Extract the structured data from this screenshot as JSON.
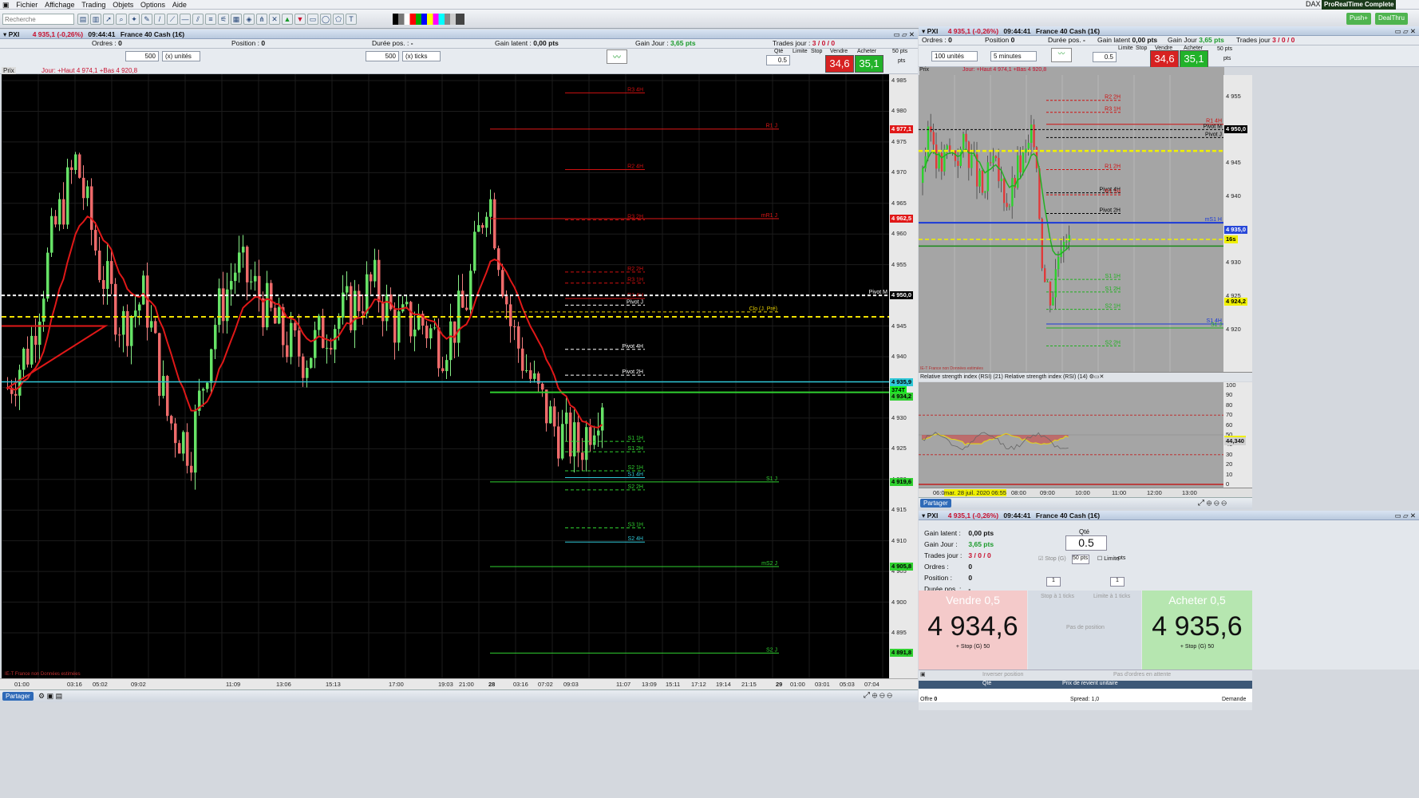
{
  "menu": {
    "items": [
      "Fichier",
      "Affichage",
      "Trading",
      "Objets",
      "Options",
      "Aide"
    ],
    "search_placeholder": "Recherche",
    "dax": "DAX",
    "product": "ProRealTime Complete",
    "push": "Push+",
    "dealthru": "DealThru"
  },
  "left": {
    "header": {
      "symbol": "PXI",
      "price": "4 935,1 (-0,26%)",
      "time": "09:44:41",
      "name": "France 40 Cash (1€)"
    },
    "orders": {
      "ordres_label": "Ordres :",
      "ordres_val": "0",
      "position_label": "Position :",
      "position_val": "0",
      "duree_label": "Durée pos. :",
      "duree_val": "-",
      "gain_latent_label": "Gain latent :",
      "gain_latent_val": "0,00 pts",
      "gain_jour_label": "Gain Jour :",
      "gain_jour_val": "3,65 pts",
      "trades_label": "Trades jour :",
      "trades_val": "3 / 0 / 0"
    },
    "qty1": "500",
    "unit1": "(x) unités",
    "qty2": "500",
    "unit2": "(x) ticks",
    "trade": {
      "qte_label": "Qté",
      "qte_val": "0.5",
      "limite": "Limite",
      "stop": "Stop",
      "vendre": "Vendre",
      "acheter": "Acheter",
      "sell_price": "4 934,6",
      "buy_price": "4 935,1",
      "sell_big": "34,6",
      "buy_big": "35,1",
      "pts": "50 pts",
      "pts2": "pts"
    },
    "chart_title": "Prix",
    "chart_sub": "Jour: +Haut 4 974,1 +Bas 4 920,8",
    "footer_note": "IE-T France non Données estimées",
    "share": "Partager",
    "price_ticks": [
      "4 985",
      "4 980",
      "4 975",
      "4 970",
      "4 965",
      "4 960",
      "4 955",
      "4 950",
      "4 945",
      "4 940",
      "4 935",
      "4 930",
      "4 925",
      "4 920",
      "4 915",
      "4 910",
      "4 905",
      "4 900",
      "4 895"
    ],
    "time_ticks": [
      "01:00",
      "03:16",
      "05:02",
      "09:02",
      "11:09",
      "13:06",
      "15:13",
      "17:00",
      "19:03",
      "21:00",
      "28",
      "03:16",
      "07:02",
      "09:03",
      "11:07",
      "13:09",
      "15:11",
      "17:12",
      "19:14",
      "21:15",
      "29",
      "01:00",
      "03:01",
      "05:03",
      "07:04"
    ],
    "levels": [
      {
        "label": "R3 4H",
        "price": 4983,
        "color": "#d01010",
        "dash": false
      },
      {
        "label": "R1 J",
        "price": 4977.1,
        "color": "#e01818",
        "dash": false
      },
      {
        "label": "R2 4H",
        "price": 4970.5,
        "color": "#d01010",
        "dash": false
      },
      {
        "label": "mR1 J",
        "price": 4962.5,
        "color": "#e01818",
        "dash": false
      },
      {
        "label": "R3 2H",
        "price": 4962.3,
        "color": "#d01010",
        "dash": true
      },
      {
        "label": "R2 2H",
        "price": 4953.8,
        "color": "#d01010",
        "dash": true
      },
      {
        "label": "R3 1H",
        "price": 4952,
        "color": "#d01010",
        "dash": true
      },
      {
        "label": "R1 4H",
        "price": 4949.5,
        "color": "#d01010",
        "dash": false
      },
      {
        "label": "Pivot M",
        "price": 4950,
        "color": "#ffffff",
        "dash": true
      },
      {
        "label": "Pivot J",
        "price": 4948.4,
        "color": "#ffffff",
        "dash": true
      },
      {
        "label": "Clo (J. Pré)",
        "price": 4947.3,
        "color": "#e8d000",
        "dash": true
      },
      {
        "label": "Pivot 4H",
        "price": 4941.2,
        "color": "#ffffff",
        "dash": true
      },
      {
        "label": "Pivot 2H",
        "price": 4937,
        "color": "#ffffff",
        "dash": true
      },
      {
        "label": "S1 1H",
        "price": 4926.2,
        "color": "#30d030",
        "dash": true
      },
      {
        "label": "S1 2H",
        "price": 4924.5,
        "color": "#30d030",
        "dash": true
      },
      {
        "label": "S2 1H",
        "price": 4921.4,
        "color": "#30d030",
        "dash": true
      },
      {
        "label": "S1 4H",
        "price": 4920.3,
        "color": "#30c8d8",
        "dash": false
      },
      {
        "label": "S1 J",
        "price": 4919.6,
        "color": "#30d030",
        "dash": false
      },
      {
        "label": "S2 2H",
        "price": 4918.3,
        "color": "#30d030",
        "dash": true
      },
      {
        "label": "S3 1H",
        "price": 4912.1,
        "color": "#30d030",
        "dash": true
      },
      {
        "label": "S2 4H",
        "price": 4909.8,
        "color": "#30c8d8",
        "dash": false
      },
      {
        "label": "mS2 J",
        "price": 4905.8,
        "color": "#30d030",
        "dash": false
      },
      {
        "label": "S2 J",
        "price": 4891.7,
        "color": "#30d030",
        "dash": false
      }
    ],
    "price_tags": [
      {
        "text": "4 950,0",
        "price": 4950,
        "bg": "#000",
        "fg": "#fff"
      },
      {
        "text": "4 935,9",
        "price": 4935.9,
        "bg": "#30c8d8",
        "fg": "#000"
      },
      {
        "text": "374T",
        "price": 4934.6,
        "bg": "#16f020",
        "fg": "#000"
      },
      {
        "text": "4 934,2",
        "price": 4933.5,
        "bg": "#30d030",
        "fg": "#000"
      },
      {
        "text": "4 977,1",
        "price": 4977.1,
        "bg": "#e01818",
        "fg": "#fff"
      },
      {
        "text": "4 962,5",
        "price": 4962.5,
        "bg": "#e01818",
        "fg": "#fff"
      },
      {
        "text": "4 919,6",
        "price": 4919.6,
        "bg": "#30d030",
        "fg": "#000"
      },
      {
        "text": "4 905,8",
        "price": 4905.8,
        "bg": "#30d030",
        "fg": "#000"
      },
      {
        "text": "4 891,8",
        "price": 4891.8,
        "bg": "#30d030",
        "fg": "#000"
      }
    ]
  },
  "right": {
    "header": {
      "symbol": "PXI",
      "price": "4 935,1 (-0,26%)",
      "time": "09:44:41",
      "name": "France 40 Cash (1€)"
    },
    "orders": {
      "ordres": "Ordres :",
      "ordres_val": "0",
      "position": "Position",
      "position_val": "0",
      "duree": "Durée pos.",
      "duree_val": "-",
      "gain_latent": "Gain latent",
      "gain_latent_val": "0,00 pts",
      "gain_jour": "Gain Jour",
      "gain_jour_val": "3,65 pts",
      "trades": "Trades jour",
      "trades_val": "3 / 0 / 0"
    },
    "units": "100 unités",
    "interval": "5 minutes",
    "trade": {
      "qte_val": "0.5",
      "limite": "Limite",
      "stop": "Stop",
      "vendre": "Vendre",
      "acheter": "Acheter",
      "sell_big": "34,6",
      "buy_big": "35,1",
      "pts": "50 pts",
      "pts2": "pts"
    },
    "chart_sub": "Jour: +Haut 4 974,1 +Bas 4 920,8",
    "chart_title": "Prix",
    "footer_note": "IE-T France non Données estimées",
    "price_ticks": [
      "4 955",
      "4 950",
      "4 945",
      "4 940",
      "4 935",
      "4 930",
      "4 925",
      "4 920"
    ],
    "price_tags": [
      {
        "text": "4 950,0",
        "price": 4950,
        "bg": "#000",
        "fg": "#fff"
      },
      {
        "text": "4 935,0",
        "price": 4935,
        "bg": "#2848d8",
        "fg": "#fff"
      },
      {
        "text": "16s",
        "price": 4933.5,
        "bg": "#f0f000",
        "fg": "#000"
      },
      {
        "text": "4 924,2",
        "price": 4924.2,
        "bg": "#f0f000",
        "fg": "#000"
      }
    ],
    "levels": [
      {
        "label": "R2 2H",
        "price": 4954.4,
        "color": "#d01010",
        "dash": true
      },
      {
        "label": "R3 1H",
        "price": 4952.6,
        "color": "#d01010",
        "dash": true
      },
      {
        "label": "R1 4H",
        "price": 4950.8,
        "color": "#d01010",
        "dash": false
      },
      {
        "label": "Pivot M",
        "price": 4950,
        "color": "#000",
        "dash": true
      },
      {
        "label": "Pivot J",
        "price": 4948.8,
        "color": "#000",
        "dash": true
      },
      {
        "label": "R1 2H",
        "price": 4944,
        "color": "#d01010",
        "dash": true
      },
      {
        "label": "Pivot 4H",
        "price": 4940.5,
        "color": "#000",
        "dash": true
      },
      {
        "label": "R1 1H",
        "price": 4940.2,
        "color": "#d01010",
        "dash": true
      },
      {
        "label": "Pivot 2H",
        "price": 4937.4,
        "color": "#000",
        "dash": true
      },
      {
        "label": "mS1 H",
        "price": 4936,
        "color": "#1a3ad8",
        "dash": false
      },
      {
        "label": "S1 1H",
        "price": 4927.5,
        "color": "#20b020",
        "dash": true
      },
      {
        "label": "S1 2H",
        "price": 4925.6,
        "color": "#20b020",
        "dash": true
      },
      {
        "label": "S2 1H",
        "price": 4923,
        "color": "#20b020",
        "dash": true
      },
      {
        "label": "S1 4H",
        "price": 4920.8,
        "color": "#1a3ad8",
        "dash": false
      },
      {
        "label": "S1 J",
        "price": 4920.2,
        "color": "#20b020",
        "dash": false
      },
      {
        "label": "S2 2H",
        "price": 4917.5,
        "color": "#20b020",
        "dash": true
      }
    ],
    "rsi_title": "Relative strength index (RSI) (21)  Relative strength index (RSI) (14)",
    "rsi_ticks": [
      "100",
      "90",
      "80",
      "70",
      "60",
      "50",
      "40",
      "30",
      "20",
      "10",
      "0"
    ],
    "rsi_tags": [
      {
        "text": "45,257",
        "val": 45.3,
        "bg": "#f0f000"
      },
      {
        "text": "44,340",
        "val": 43.3,
        "bg": "#d0d0d0"
      }
    ],
    "time_ticks": [
      "06:0",
      "mar. 28 juil. 2020 06:55",
      "08:00",
      "09:00",
      "10:00",
      "11:00",
      "12:00",
      "13:00"
    ],
    "share": "Partager"
  },
  "ticket": {
    "header": {
      "symbol": "PXI",
      "price": "4 935,1 (-0,26%)",
      "time": "09:44:41",
      "name": "France 40 Cash (1€)"
    },
    "gain_latent": "Gain latent :",
    "gain_latent_val": "0,00 pts",
    "gain_jour": "Gain Jour :",
    "gain_jour_val": "3,65 pts",
    "trades": "Trades jour :",
    "trades_val": "3 / 0 / 0",
    "ordres": "Ordres :",
    "ordres_val": "0",
    "position": "Position :",
    "position_val": "0",
    "duree": "Durée pos. :",
    "duree_val": "-",
    "qte_label": "Qté",
    "qte_val": "0.5",
    "stop_label": "Stop (G)",
    "stop_pts": "50 pts",
    "limite": "Limite",
    "limite_pts": "pts",
    "stepper1": "1",
    "stepper2": "1",
    "sell_title": "Vendre 0,5",
    "sell_price": "4 934,6",
    "sell_sub": "+ Stop (G) 50",
    "buy_title": "Acheter 0,5",
    "buy_price": "4 935,6",
    "buy_sub": "+ Stop (G) 50",
    "stop_a": "Stop à 1 ticks",
    "limite_a": "Limite à 1 ticks",
    "pas_pos": "Pas de position",
    "inverser": "Inverser position",
    "pas_ordres": "Pas d'ordres en attente",
    "col_qte": "Qté",
    "col_prix": "Prix de revient unitaire",
    "offre": "Offre",
    "offre_val": "0",
    "spread": "Spread: 1,0",
    "demande": "Demande"
  }
}
